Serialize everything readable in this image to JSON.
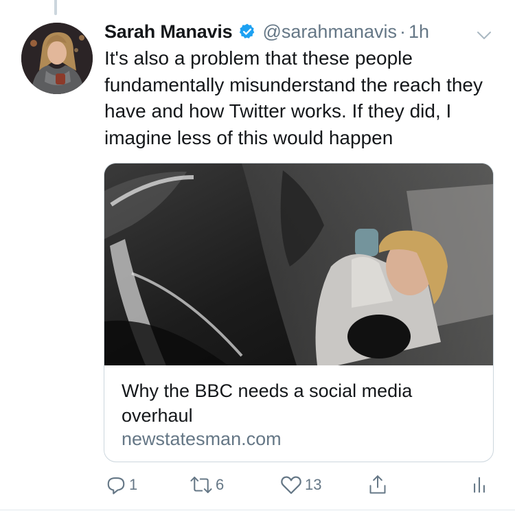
{
  "tweet": {
    "author_name": "Sarah Manavis",
    "handle": "@sarahmanavis",
    "separator": "·",
    "time": "1h",
    "verified": true,
    "text": "It's also a problem that these people fundamentally misunderstand the reach they have and how Twitter works. If they did, I imagine less of this would happen"
  },
  "card": {
    "title": "Why the BBC needs a social media overhaul",
    "domain": "newstatesman.com"
  },
  "actions": {
    "reply_count": "1",
    "retweet_count": "6",
    "like_count": "13"
  },
  "icons": {
    "verified": "verified-badge-icon",
    "caret": "chevron-down-icon",
    "reply": "reply-icon",
    "retweet": "retweet-icon",
    "like": "heart-icon",
    "share": "share-icon",
    "analytics": "analytics-icon"
  },
  "colors": {
    "accent": "#1da1f2",
    "secondary_text": "#657786",
    "primary_text": "#14171a",
    "border": "#ccd6dd"
  }
}
